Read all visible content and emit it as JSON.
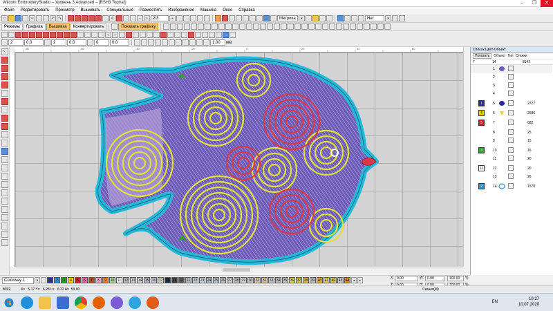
{
  "window": {
    "title": "Wilcom EmbroideryStudio – Уровень 3 Advanced – [RSH3     Top/ral]",
    "controls": [
      "–",
      "❐",
      "✕"
    ]
  },
  "menu": [
    "Файл",
    "Редактировать",
    "Просмотр",
    "Вышивать",
    "Специальные",
    "Разместить",
    "Изображение",
    "Машина",
    "Окно",
    "Справка"
  ],
  "toolbar1": {
    "modes": [
      "Режимы",
      "Графика",
      "Вышивка",
      "Конвертировать"
    ],
    "show_graphics": "Показать графику",
    "zoom_value": "2/3",
    "units": "Метрика",
    "no_label": "Нет"
  },
  "toolbar2": {
    "val1": "2",
    "val2": "0.0",
    "val3": "2",
    "val4": "0.0",
    "val5": "0",
    "val6": "0.0",
    "val7": "1.00",
    "unit": "мм"
  },
  "ruler_labels": [
    "-80",
    "-70",
    "-60",
    "-50",
    "-40",
    "-30",
    "-20",
    "-10",
    "0",
    "10",
    "20",
    "30",
    "40",
    "50",
    "60",
    "70",
    "80"
  ],
  "panel": {
    "title": "Список Цвет-Объект",
    "filter": "Показать",
    "headers": [
      "Объект",
      "Тип",
      "Стежки"
    ],
    "top_values": [
      "7",
      "14",
      "8142"
    ],
    "rows": [
      {
        "num": "1",
        "count": ""
      },
      {
        "num": "2",
        "count": ""
      },
      {
        "num": "3",
        "count": ""
      },
      {
        "num": "4",
        "count": ""
      },
      {
        "num": "5",
        "swatch": "1",
        "color": "#2b2a9a",
        "count": "2727"
      },
      {
        "num": "6",
        "swatch": "4",
        "color": "#f2d400",
        "count": "2686"
      },
      {
        "num": "7",
        "swatch": "5",
        "color": "#cc1f26",
        "count": "682"
      },
      {
        "num": "8",
        "count": "25"
      },
      {
        "num": "9",
        "count": "15"
      },
      {
        "num": "10",
        "swatch": "3",
        "color": "#2ca02c",
        "count": "16"
      },
      {
        "num": "11",
        "count": "20"
      },
      {
        "num": "12",
        "swatch": "11",
        "color": "#ffffff",
        "count": "20"
      },
      {
        "num": "13",
        "count": "26"
      },
      {
        "num": "14",
        "swatch": "2",
        "color": "#2b8fd6",
        "count": "1570"
      }
    ]
  },
  "colorbar": {
    "colorway": "Colorway 1",
    "swatches": [
      {
        "n": "1",
        "c": "#2a3b9c"
      },
      {
        "n": "2",
        "c": "#2b8fd6"
      },
      {
        "n": "3",
        "c": "#2ca02c"
      },
      {
        "n": "4",
        "c": "#f2d400"
      },
      {
        "n": "5",
        "c": "#cc1f26"
      },
      {
        "n": "6",
        "c": "#e26aa8"
      },
      {
        "n": "7",
        "c": "#a0522d"
      },
      {
        "n": "8",
        "c": "#f7a8c8"
      },
      {
        "n": "9",
        "c": "#f08030"
      },
      {
        "n": "10",
        "c": "#b0d890"
      },
      {
        "n": "11",
        "c": "#ffffff"
      },
      {
        "n": "12",
        "c": "#c0c0c0"
      },
      {
        "n": "13",
        "c": "#d0d0d0"
      },
      {
        "n": "14",
        "c": "#d8d8d8"
      },
      {
        "n": "15",
        "c": "#b8b8c8"
      },
      {
        "n": "16",
        "c": "#ccccdd"
      },
      {
        "n": "17",
        "c": "#d8d0c0"
      },
      {
        "n": "18",
        "c": "#203040"
      },
      {
        "n": "19",
        "c": "#404040"
      },
      {
        "n": "20",
        "c": "#606060"
      },
      {
        "n": "21",
        "c": "#c0c0c0"
      },
      {
        "n": "22",
        "c": "#c8d0d8"
      },
      {
        "n": "23",
        "c": "#d0d8e0"
      },
      {
        "n": "24",
        "c": "#b8c0c8"
      },
      {
        "n": "25",
        "c": "#c0c8d0"
      },
      {
        "n": "26",
        "c": "#c8c8c8"
      },
      {
        "n": "27",
        "c": "#d0d0d0"
      },
      {
        "n": "28",
        "c": "#c0c0c0"
      },
      {
        "n": "29",
        "c": "#d8d8d8"
      },
      {
        "n": "30",
        "c": "#c8c8c8"
      },
      {
        "n": "31",
        "c": "#d8c8a8"
      },
      {
        "n": "32",
        "c": "#e0c890"
      },
      {
        "n": "33",
        "c": "#d0d0d0"
      },
      {
        "n": "34",
        "c": "#c0c0c0"
      },
      {
        "n": "35",
        "c": "#c8c8c8"
      },
      {
        "n": "36",
        "c": "#e8d870"
      },
      {
        "n": "37",
        "c": "#e0c060"
      },
      {
        "n": "38",
        "c": "#e8c050"
      },
      {
        "n": "39",
        "c": "#c8c8c8"
      },
      {
        "n": "40",
        "c": "#e0b040"
      },
      {
        "n": "41",
        "c": "#e8c870"
      },
      {
        "n": "42",
        "c": "#d8c060"
      },
      {
        "n": "43",
        "c": "#c8c8c8"
      },
      {
        "n": "44",
        "c": "#d09030"
      }
    ]
  },
  "coords": {
    "x_label": "X:",
    "x": "0.00",
    "y_label": "Y:",
    "y": "0.00",
    "w_label": "W:",
    "w": "0.00",
    "h_label": "H:",
    "h": "0.00",
    "sx": "100.00",
    "sy": "100.00",
    "pct": "%"
  },
  "status": {
    "left": "8392",
    "coords": "X=   5.17 Y=   6.28 L=   6.22 A=  53.00",
    "mode": "Скачок(М)"
  },
  "taskbar": {
    "lang": "EN",
    "time": "19:27",
    "date": "10.07.2020"
  }
}
